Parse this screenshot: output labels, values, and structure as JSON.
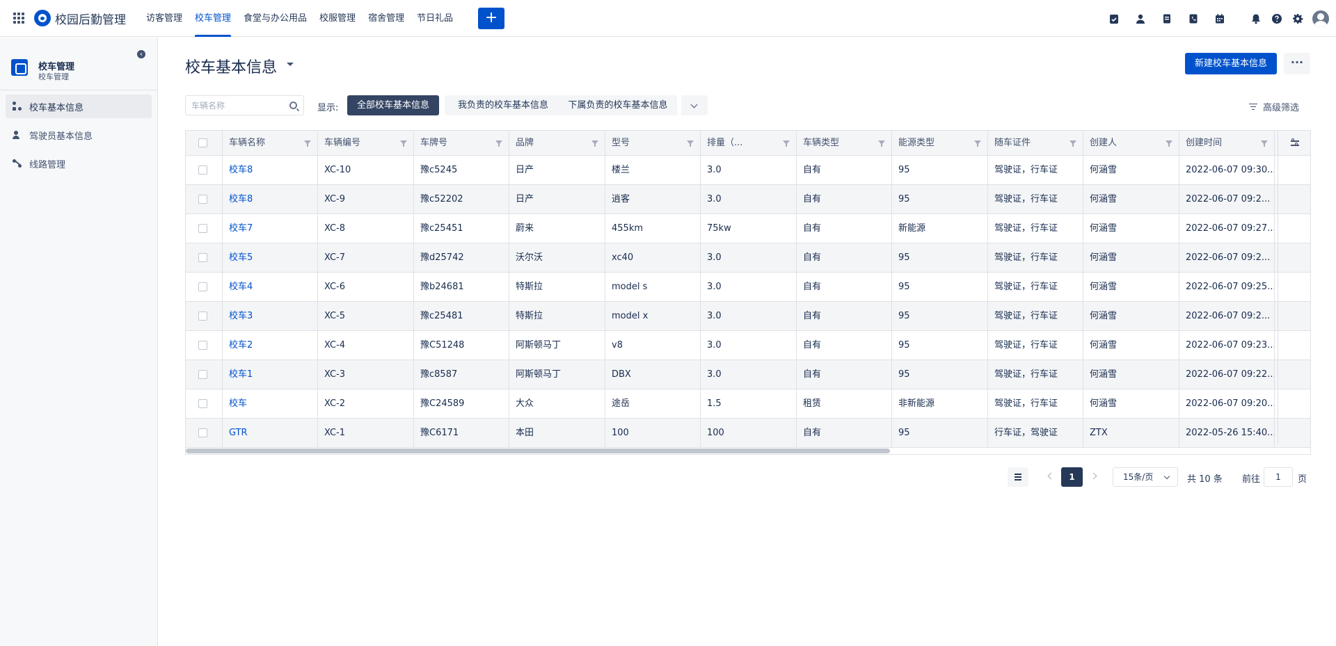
{
  "app": {
    "title": "校园后勤管理"
  },
  "topnav": [
    {
      "label": "访客管理",
      "active": false
    },
    {
      "label": "校车管理",
      "active": true
    },
    {
      "label": "食堂与办公用品",
      "active": false
    },
    {
      "label": "校服管理",
      "active": false
    },
    {
      "label": "宿舍管理",
      "active": false
    },
    {
      "label": "节日礼品",
      "active": false
    }
  ],
  "topbar_icons": [
    "task-check-icon",
    "contacts-icon",
    "document-icon",
    "phone-book-icon",
    "calendar-icon",
    "bell-icon",
    "help-icon",
    "gear-icon"
  ],
  "sidebar": {
    "project_title": "校车管理",
    "project_sub": "校车管理",
    "items": [
      {
        "label": "校车基本信息",
        "active": true
      },
      {
        "label": "驾驶员基本信息",
        "active": false
      },
      {
        "label": "线路管理",
        "active": false
      }
    ]
  },
  "page": {
    "title": "校车基本信息",
    "new_button": "新建校车基本信息",
    "more_button": "···"
  },
  "filters": {
    "search_placeholder": "车辆名称",
    "show_label": "显示:",
    "buttons": [
      "全部校车基本信息",
      "我负责的校车基本信息",
      "下属负责的校车基本信息"
    ],
    "advanced": "高级筛选"
  },
  "table": {
    "columns": [
      "车辆名称",
      "车辆编号",
      "车牌号",
      "品牌",
      "型号",
      "排量（...",
      "车辆类型",
      "能源类型",
      "随车证件",
      "创建人",
      "创建时间"
    ],
    "rows": [
      [
        "校车8",
        "XC-10",
        "豫c5245",
        "日产",
        "楼兰",
        "3.0",
        "自有",
        "95",
        "驾驶证，行车证",
        "何涵雪",
        "2022-06-07 09:30..."
      ],
      [
        "校车8",
        "XC-9",
        "豫c52202",
        "日产",
        "逍客",
        "3.0",
        "自有",
        "95",
        "驾驶证，行车证",
        "何涵雪",
        "2022-06-07 09:2..."
      ],
      [
        "校车7",
        "XC-8",
        "豫c25451",
        "蔚来",
        "455km",
        "75kw",
        "自有",
        "新能源",
        "驾驶证，行车证",
        "何涵雪",
        "2022-06-07 09:27..."
      ],
      [
        "校车5",
        "XC-7",
        "豫d25742",
        "沃尔沃",
        "xc40",
        "3.0",
        "自有",
        "95",
        "驾驶证，行车证",
        "何涵雪",
        "2022-06-07 09:2..."
      ],
      [
        "校车4",
        "XC-6",
        "豫b24681",
        "特斯拉",
        "model s",
        "3.0",
        "自有",
        "95",
        "驾驶证，行车证",
        "何涵雪",
        "2022-06-07 09:25..."
      ],
      [
        "校车3",
        "XC-5",
        "豫c25481",
        "特斯拉",
        "model x",
        "3.0",
        "自有",
        "95",
        "驾驶证，行车证",
        "何涵雪",
        "2022-06-07 09:2..."
      ],
      [
        "校车2",
        "XC-4",
        "豫C51248",
        "阿斯顿马丁",
        "v8",
        "3.0",
        "自有",
        "95",
        "驾驶证，行车证",
        "何涵雪",
        "2022-06-07 09:23..."
      ],
      [
        "校车1",
        "XC-3",
        "豫c8587",
        "阿斯顿马丁",
        "DBX",
        "3.0",
        "自有",
        "95",
        "驾驶证，行车证",
        "何涵雪",
        "2022-06-07 09:22..."
      ],
      [
        "校车",
        "XC-2",
        "豫C24589",
        "大众",
        "途岳",
        "1.5",
        "租赁",
        "非新能源",
        "驾驶证，行车证",
        "何涵雪",
        "2022-06-07 09:20..."
      ],
      [
        "GTR",
        "XC-1",
        "豫C6171",
        "本田",
        "100",
        "100",
        "自有",
        "95",
        "行车证，驾驶证",
        "ZTX",
        "2022-05-26 15:40..."
      ]
    ]
  },
  "pagination": {
    "current": "1",
    "page_size": "15条/页",
    "total": "共 10 条",
    "goto_label": "前往",
    "goto_value": "1",
    "page_suffix": "页"
  },
  "colors": {
    "primary": "#0052cc",
    "dark": "#344563"
  }
}
